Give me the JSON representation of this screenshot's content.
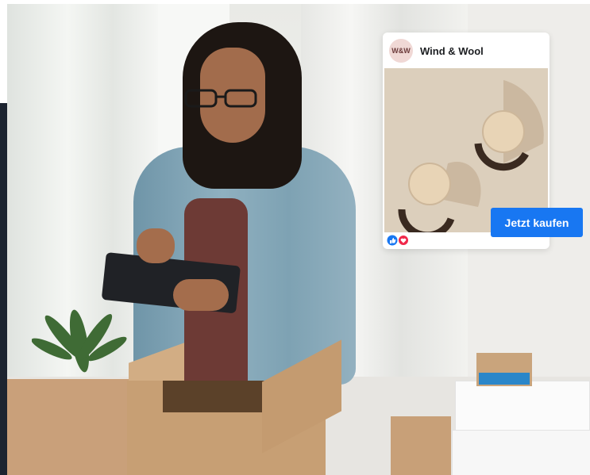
{
  "post": {
    "avatar_text": "W&W",
    "brand_name": "Wind & Wool",
    "cta_label": "Jetzt kaufen",
    "reactions": [
      "like-icon",
      "love-icon"
    ]
  },
  "colors": {
    "cta": "#1877f2",
    "love": "#f0284a",
    "dark_strip": "#1c2430"
  }
}
